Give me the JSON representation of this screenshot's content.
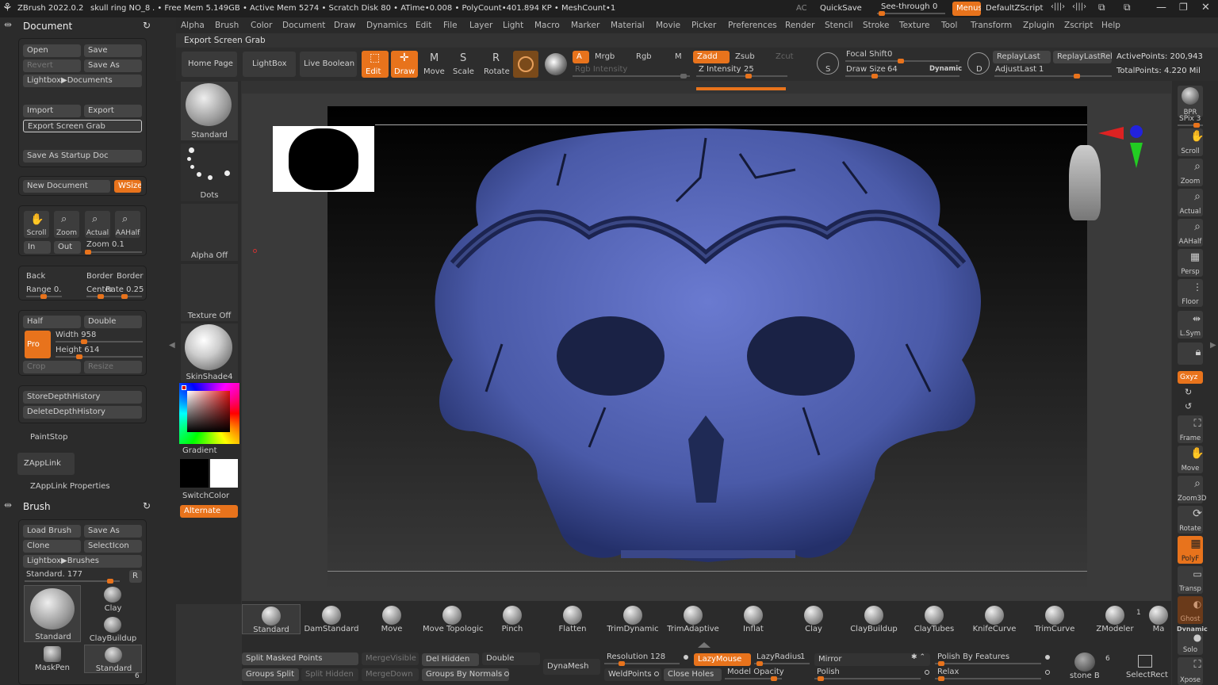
{
  "titlebar": {
    "app": "ZBrush 2022.0.2",
    "doc": "skull ring NO_8",
    "stats": ". • Free Mem 5.149GB • Active Mem 5274 • Scratch Disk 80 • ATime•0.008 • PolyCount•401.894 KP • MeshCount•1",
    "ac": "AC",
    "quicksave": "QuickSave",
    "seethrough": "See-through",
    "seethrough_val": "0",
    "menus": "Menus",
    "script": "DefaultZScript"
  },
  "menubar": [
    "Alpha",
    "Brush",
    "Color",
    "Document",
    "Draw",
    "Dynamics",
    "Edit",
    "File",
    "Layer",
    "Light",
    "Macro",
    "Marker",
    "Material",
    "Movie",
    "Picker",
    "Preferences",
    "Render",
    "Stencil",
    "Stroke",
    "Texture",
    "Tool",
    "Transform",
    "Zplugin",
    "Zscript",
    "Help"
  ],
  "tooltip": "Export Screen Grab",
  "document": {
    "title": "Document",
    "open": "Open",
    "save": "Save",
    "revert": "Revert",
    "saveas": "Save As",
    "lightbox": "Lightbox▶Documents",
    "import": "Import",
    "export": "Export",
    "exportgrab": "Export Screen Grab",
    "startup": "Save As Startup Doc",
    "newdoc": "New Document",
    "wsize": "WSize",
    "scroll": "Scroll",
    "zoom": "Zoom",
    "actual": "Actual",
    "aahalf": "AAHalf",
    "in": "In",
    "out": "Out",
    "zoomval": "Zoom 0.1",
    "back": "Back",
    "border1": "Border",
    "border2": "Border",
    "range": "Range 0.",
    "center": "Center",
    "rate": "Rate 0.25",
    "half": "Half",
    "double": "Double",
    "pro": "Pro",
    "width": "Width 958",
    "height": "Height 614",
    "crop": "Crop",
    "resize": "Resize",
    "storedepth": "StoreDepthHistory",
    "deletedepth": "DeleteDepthHistory",
    "paintstop": "PaintStop",
    "zapplink": "ZAppLink",
    "zapplinkprops": "ZAppLink Properties"
  },
  "brush": {
    "title": "Brush",
    "load": "Load Brush",
    "saveas": "Save As",
    "clone": "Clone",
    "selecticon": "SelectIcon",
    "lightbox": "Lightbox▶Brushes",
    "standard": "Standard. 177",
    "r": "R",
    "big_label": "Standard",
    "clay": "Clay",
    "claybuildup": "ClayBuildup",
    "maskpen": "MaskPen",
    "standard2": "Standard",
    "count": "6"
  },
  "toolbar": {
    "home": "Home Page",
    "lightbox": "LightBox",
    "liveboolean": "Live Boolean",
    "edit": "Edit",
    "draw": "Draw",
    "move": "Move",
    "scale": "Scale",
    "rotate": "Rotate",
    "a": "A",
    "mrgb": "Mrgb",
    "rgb": "Rgb",
    "m": "M",
    "zadd": "Zadd",
    "zsub": "Zsub",
    "zcut": "Zcut",
    "rgbint": "Rgb Intensity",
    "zint": "Z Intensity",
    "zint_val": "25",
    "focal": "Focal Shift",
    "focal_val": "0",
    "drawsize": "Draw Size",
    "drawsize_val": "64",
    "dynamic": "Dynamic",
    "replaylast": "ReplayLast",
    "replaylastrel": "ReplayLastRel",
    "adjustlast": "AdjustLast",
    "adjustlast_val": "1",
    "activepoints": "ActivePoints: 200,943",
    "totalpoints": "TotalPoints: 4.220 Mil",
    "s": "S",
    "d": "D"
  },
  "leftshelf": {
    "standard": "Standard",
    "dots": "Dots",
    "alpha": "Alpha Off",
    "texture": "Texture Off",
    "material": "SkinShade4",
    "gradient": "Gradient",
    "switchcolor": "SwitchColor",
    "alternate": "Alternate"
  },
  "right": {
    "bpr": "BPR",
    "spix": "SPix 3",
    "scroll": "Scroll",
    "zoom": "Zoom",
    "actual": "Actual",
    "aahalf": "AAHalf",
    "persp": "Persp",
    "floor": "Floor",
    "lsym": "L.Sym",
    "xyz": "Gxyz",
    "frame": "Frame",
    "move": "Move",
    "zoom3d": "Zoom3D",
    "rotate": "Rotate",
    "polyf": "PolyF",
    "transp": "Transp",
    "ghost": "Ghost",
    "solo": "Solo",
    "xpose": "Xpose",
    "dynamic": "Dynamic"
  },
  "brushshelf": [
    "Standard",
    "DamStandard",
    "Move",
    "Move Topologic",
    "Pinch",
    "Flatten",
    "TrimDynamic",
    "TrimAdaptive",
    "Inflat",
    "Clay",
    "ClayBuildup",
    "ClayTubes",
    "KnifeCurve",
    "TrimCurve",
    "ZModeler",
    "Ma"
  ],
  "zmodeler_count": "1",
  "bottom": {
    "splitmasked": "Split Masked Points",
    "mergevisible": "MergeVisible",
    "delhidden": "Del Hidden",
    "double": "Double",
    "groupssplit": "Groups Split",
    "splithidden": "Split Hidden",
    "mergedown": "MergeDown",
    "groupsbynormals": "Groups By Normals",
    "dynamesh": "DynaMesh",
    "resolution": "Resolution",
    "resolution_val": "128",
    "lazymouse": "LazyMouse",
    "lazyradius": "LazyRadius",
    "lazyradius_val": "1",
    "weldpoints": "WeldPoints",
    "closeholes": "Close Holes",
    "modelopacity": "Model Opacity",
    "mirror": "Mirror",
    "polish": "Polish",
    "polishfeatures": "Polish By Features",
    "relax": "Relax",
    "stoneb": "stone B",
    "stoneb_count": "6",
    "selectrect": "SelectRect"
  },
  "colors": {
    "accent": "#e8731c",
    "mesh": "#4a5aa8"
  }
}
